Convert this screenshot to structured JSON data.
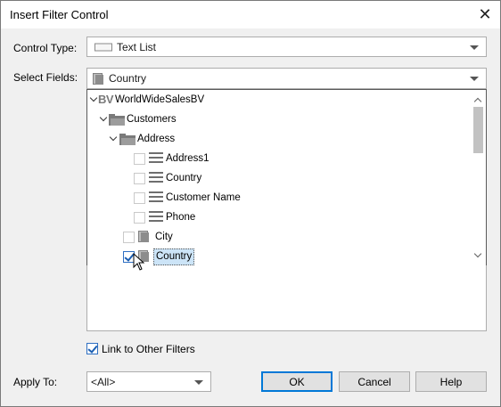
{
  "dialog": {
    "title": "Insert Filter Control",
    "close_icon": "close-icon"
  },
  "control_type": {
    "label": "Control Type:",
    "value": "Text List",
    "icon": "text-list-icon"
  },
  "select_fields": {
    "label": "Select Fields:",
    "value": "Country",
    "icon": "field-icon"
  },
  "tree": {
    "root": {
      "label": "WorldWideSalesBV",
      "icon": "bv-icon",
      "expanded": true
    },
    "customers": {
      "label": "Customers",
      "icon": "folder-icon",
      "expanded": true
    },
    "address": {
      "label": "Address",
      "icon": "folder-icon",
      "expanded": true
    },
    "address_fields": [
      {
        "label": "Address1",
        "checked": false
      },
      {
        "label": "Country",
        "checked": false
      },
      {
        "label": "Customer Name",
        "checked": false
      },
      {
        "label": "Phone",
        "checked": false
      }
    ],
    "customer_fields": [
      {
        "label": "City",
        "checked": false
      },
      {
        "label": "Country",
        "checked": true,
        "selected": true
      }
    ]
  },
  "link_filters": {
    "label": "Link to Other Filters",
    "checked": true
  },
  "apply_to": {
    "label": "Apply To:",
    "value": "<All>"
  },
  "buttons": {
    "ok": "OK",
    "cancel": "Cancel",
    "help": "Help"
  },
  "colors": {
    "accent": "#0078d7",
    "selection": "#cce4f7",
    "check": "#1b5fb3"
  }
}
